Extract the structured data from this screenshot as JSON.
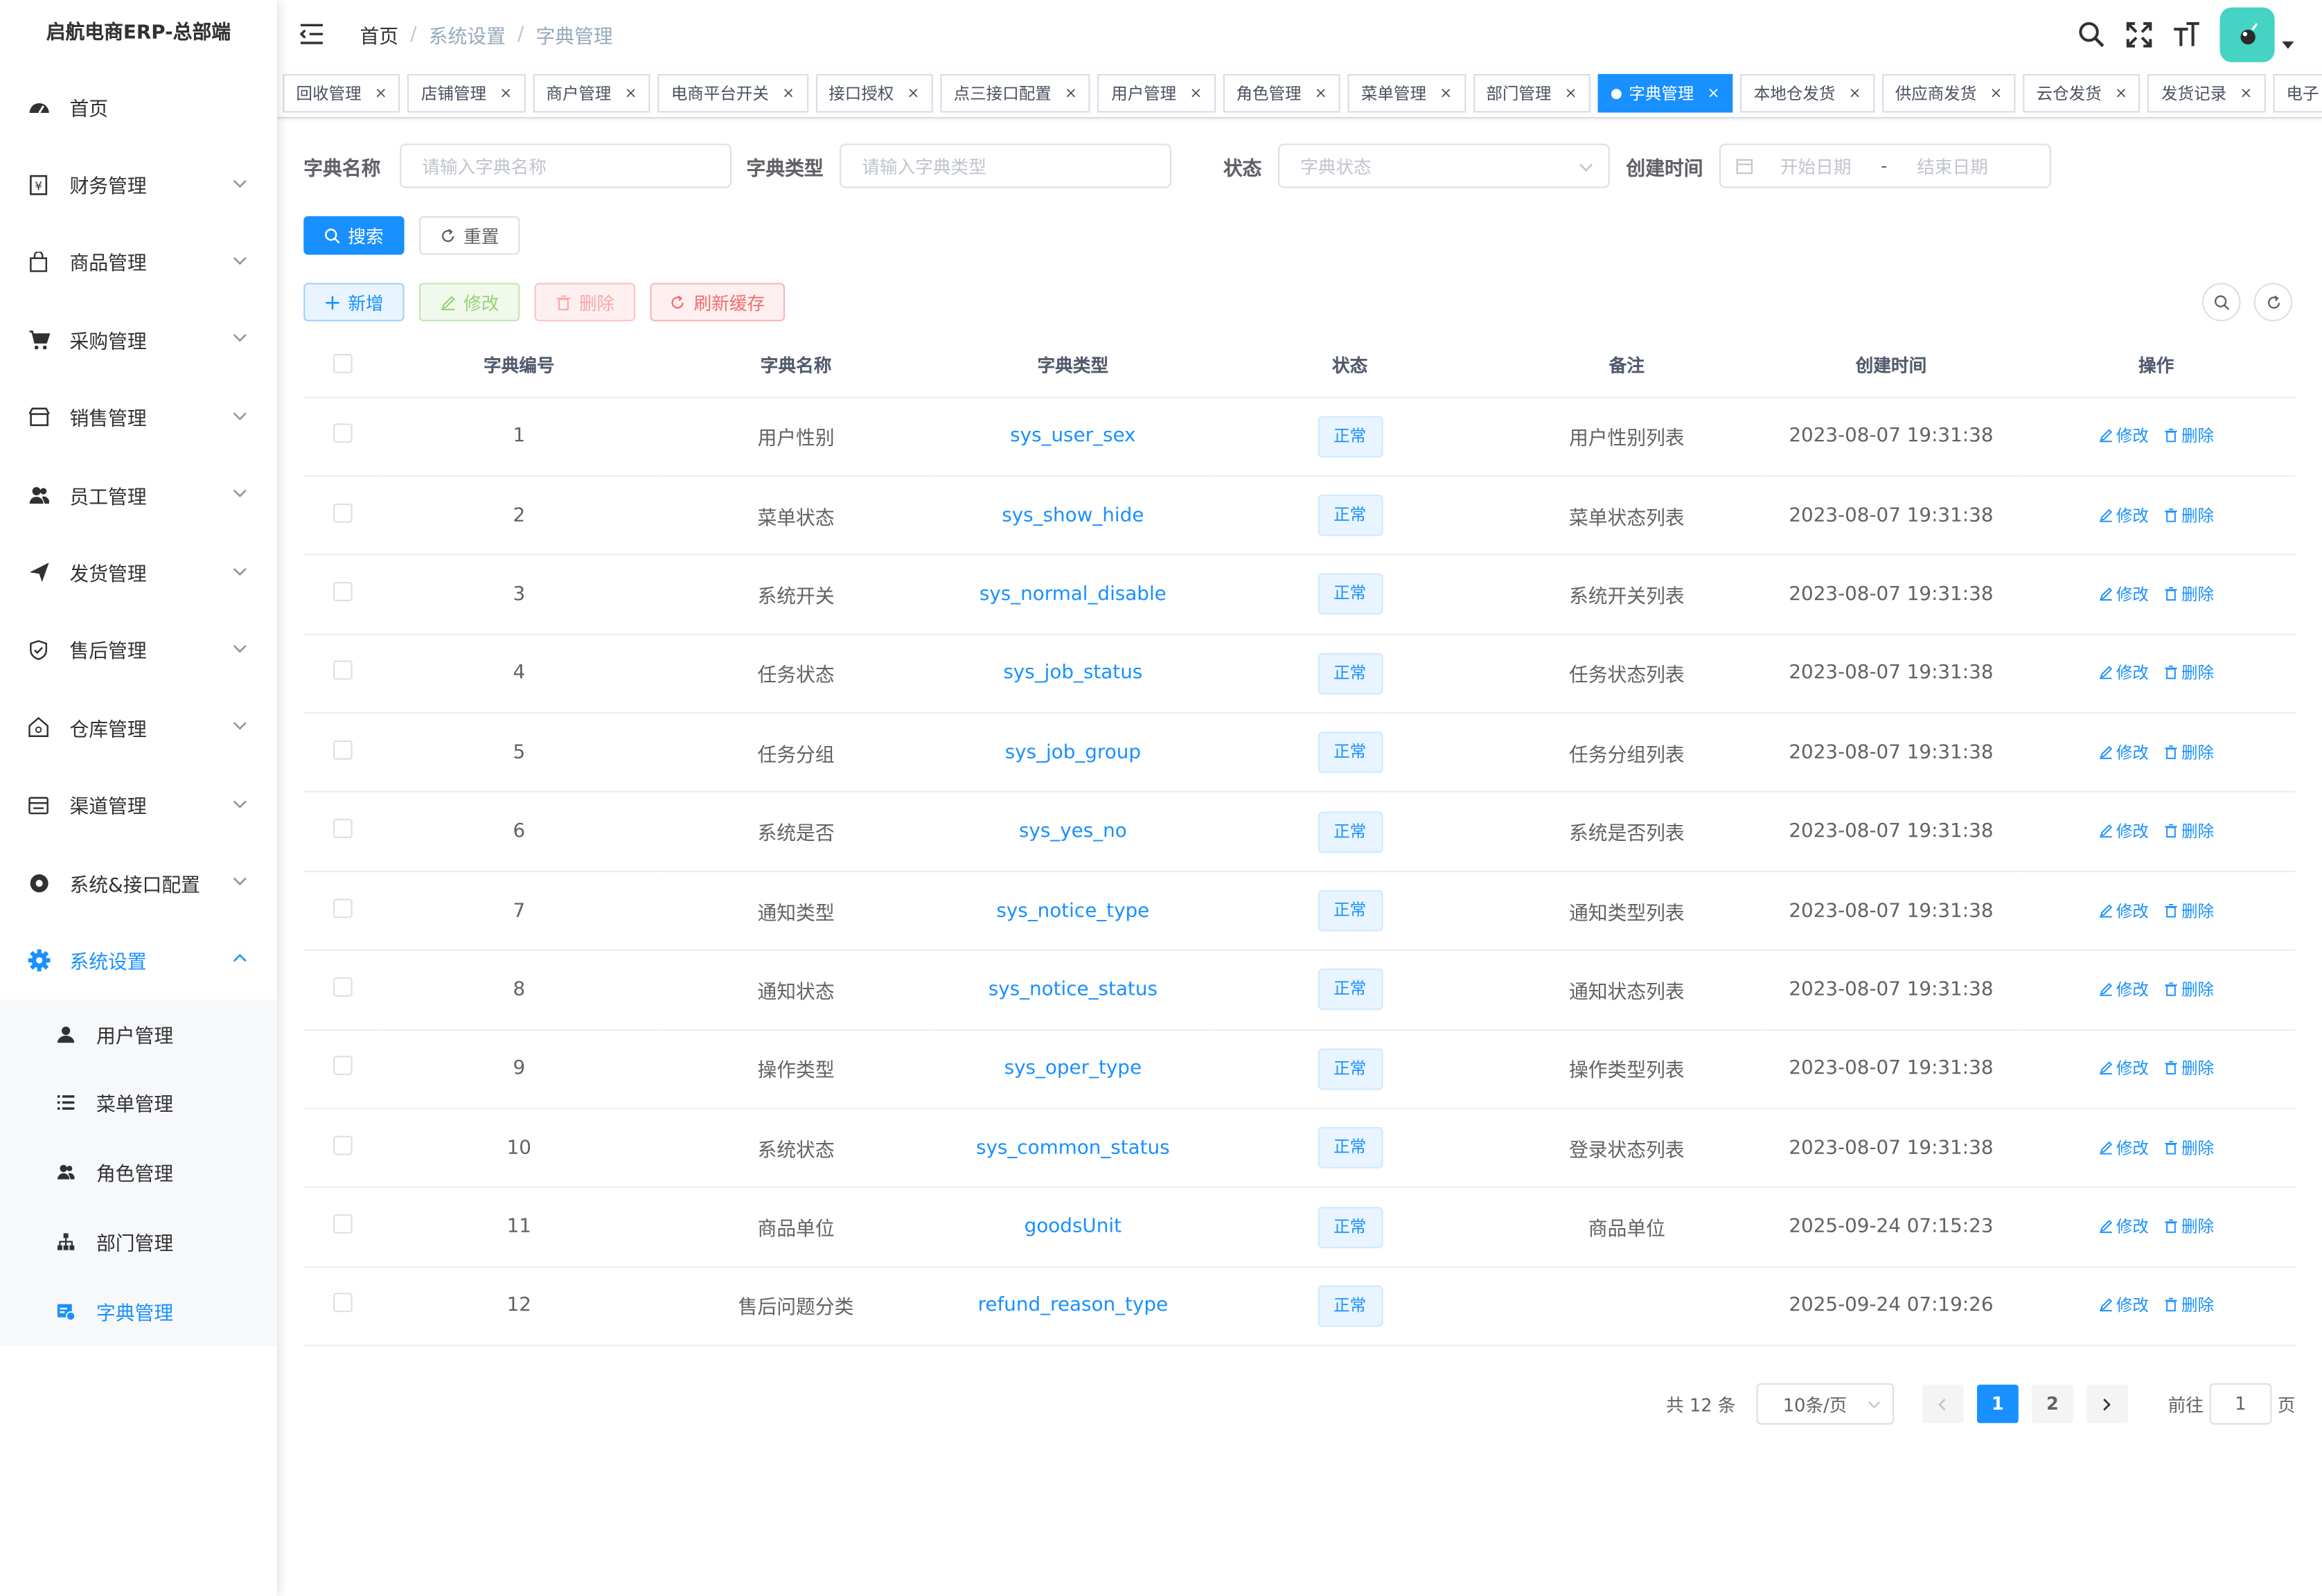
{
  "app": {
    "title": "启航电商ERP-总部端"
  },
  "sidebar": {
    "items": [
      {
        "label": "首页",
        "icon": "dashboard-icon"
      },
      {
        "label": "财务管理",
        "icon": "finance-icon"
      },
      {
        "label": "商品管理",
        "icon": "shopping-bag-icon"
      },
      {
        "label": "采购管理",
        "icon": "cart-icon"
      },
      {
        "label": "销售管理",
        "icon": "store-icon"
      },
      {
        "label": "员工管理",
        "icon": "people-icon"
      },
      {
        "label": "发货管理",
        "icon": "send-icon"
      },
      {
        "label": "售后管理",
        "icon": "shield-icon"
      },
      {
        "label": "仓库管理",
        "icon": "warehouse-icon"
      },
      {
        "label": "渠道管理",
        "icon": "channel-icon"
      },
      {
        "label": "系统&接口配置",
        "icon": "api-icon"
      },
      {
        "label": "系统设置",
        "icon": "gear-icon"
      }
    ],
    "submenu": [
      {
        "label": "用户管理",
        "icon": "user-icon"
      },
      {
        "label": "菜单管理",
        "icon": "list-icon"
      },
      {
        "label": "角色管理",
        "icon": "role-icon"
      },
      {
        "label": "部门管理",
        "icon": "tree-icon"
      },
      {
        "label": "字典管理",
        "icon": "dict-icon"
      }
    ]
  },
  "breadcrumb": [
    "首页",
    "系统设置",
    "字典管理"
  ],
  "tags": [
    "回收管理",
    "店铺管理",
    "商户管理",
    "电商平台开关",
    "接口授权",
    "点三接口配置",
    "用户管理",
    "角色管理",
    "菜单管理",
    "部门管理",
    "字典管理",
    "本地仓发货",
    "供应商发货",
    "云仓发货",
    "发货记录",
    "电子"
  ],
  "tags_close": "×",
  "search": {
    "name_label": "字典名称",
    "name_placeholder": "请输入字典名称",
    "type_label": "字典类型",
    "type_placeholder": "请输入字典类型",
    "status_label": "状态",
    "status_placeholder": "字典状态",
    "time_label": "创建时间",
    "start_placeholder": "开始日期",
    "range_sep": "-",
    "end_placeholder": "结束日期",
    "search_btn": "搜索",
    "reset_btn": "重置"
  },
  "toolbar": {
    "add": "新增",
    "edit": "修改",
    "delete": "删除",
    "refresh_cache": "刷新缓存"
  },
  "table": {
    "headers": [
      "字典编号",
      "字典名称",
      "字典类型",
      "状态",
      "备注",
      "创建时间",
      "操作"
    ],
    "edit_label": "修改",
    "delete_label": "删除",
    "rows": [
      {
        "id": "1",
        "name": "用户性别",
        "type": "sys_user_sex",
        "status": "正常",
        "remark": "用户性别列表",
        "time": "2023-08-07 19:31:38"
      },
      {
        "id": "2",
        "name": "菜单状态",
        "type": "sys_show_hide",
        "status": "正常",
        "remark": "菜单状态列表",
        "time": "2023-08-07 19:31:38"
      },
      {
        "id": "3",
        "name": "系统开关",
        "type": "sys_normal_disable",
        "status": "正常",
        "remark": "系统开关列表",
        "time": "2023-08-07 19:31:38"
      },
      {
        "id": "4",
        "name": "任务状态",
        "type": "sys_job_status",
        "status": "正常",
        "remark": "任务状态列表",
        "time": "2023-08-07 19:31:38"
      },
      {
        "id": "5",
        "name": "任务分组",
        "type": "sys_job_group",
        "status": "正常",
        "remark": "任务分组列表",
        "time": "2023-08-07 19:31:38"
      },
      {
        "id": "6",
        "name": "系统是否",
        "type": "sys_yes_no",
        "status": "正常",
        "remark": "系统是否列表",
        "time": "2023-08-07 19:31:38"
      },
      {
        "id": "7",
        "name": "通知类型",
        "type": "sys_notice_type",
        "status": "正常",
        "remark": "通知类型列表",
        "time": "2023-08-07 19:31:38"
      },
      {
        "id": "8",
        "name": "通知状态",
        "type": "sys_notice_status",
        "status": "正常",
        "remark": "通知状态列表",
        "time": "2023-08-07 19:31:38"
      },
      {
        "id": "9",
        "name": "操作类型",
        "type": "sys_oper_type",
        "status": "正常",
        "remark": "操作类型列表",
        "time": "2023-08-07 19:31:38"
      },
      {
        "id": "10",
        "name": "系统状态",
        "type": "sys_common_status",
        "status": "正常",
        "remark": "登录状态列表",
        "time": "2023-08-07 19:31:38"
      },
      {
        "id": "11",
        "name": "商品单位",
        "type": "goodsUnit",
        "status": "正常",
        "remark": "商品单位",
        "time": "2025-09-24 07:15:23"
      },
      {
        "id": "12",
        "name": "售后问题分类",
        "type": "refund_reason_type",
        "status": "正常",
        "remark": "",
        "time": "2025-09-24 07:19:26"
      }
    ]
  },
  "pagination": {
    "total": "共 12 条",
    "page_size": "10条/页",
    "pages": [
      "1",
      "2"
    ],
    "goto_label": "前往",
    "goto_value": "1",
    "page_unit": "页"
  },
  "colors": {
    "primary": "#1890ff",
    "avatar_bg": "#45d3c4"
  }
}
